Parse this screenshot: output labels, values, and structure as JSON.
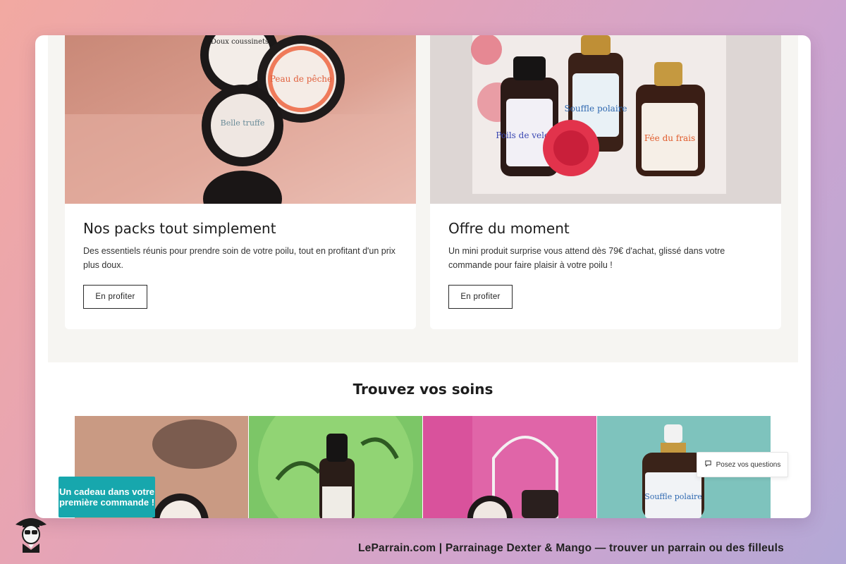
{
  "cards": [
    {
      "title": "Nos packs tout simplement",
      "text": "Des essentiels réunis pour prendre soin de votre poilu, tout en profitant d'un prix plus doux.",
      "button": "En profiter",
      "labels": [
        "Doux coussinets",
        "Peau de pêche",
        "Belle truffe"
      ]
    },
    {
      "title": "Offre du moment",
      "text": "Un mini produit surprise vous attend dès 79€ d'achat, glissé dans votre commande pour faire plaisir à votre poilu !",
      "button": "En profiter",
      "labels": [
        "Poils de velours",
        "Souffle polaire",
        "Fée du frais"
      ]
    }
  ],
  "section": {
    "title": "Trouvez vos soins"
  },
  "tile_labels": [
    "Souffle polaire"
  ],
  "gift_banner": "Un cadeau dans votre première commande !",
  "ask_button": "Posez vos questions",
  "footer": "LeParrain.com | Parrainage Dexter & Mango — trouver un parrain ou des filleuls",
  "colors": {
    "accent": "#17a7ad",
    "card_bg": "#ffffff",
    "band_bg": "#f6f5f2"
  },
  "icons": [
    "chat-bubble-icon",
    "mascot-icon"
  ]
}
